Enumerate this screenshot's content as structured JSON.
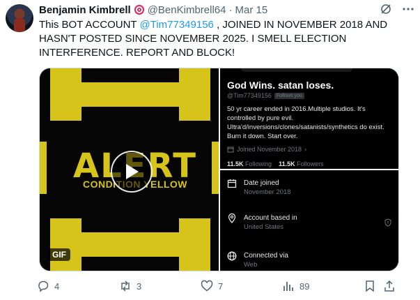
{
  "author": {
    "name": "Benjamin Kimbrell",
    "badge_icon": "target-icon",
    "handle": "@BenKimbrell64",
    "separator": "·",
    "date": "Mar 15"
  },
  "tweet": {
    "text_before": "This BOT ACCOUNT ",
    "mention": "@Tim77349156",
    "text_after": " , JOINED IN NOVEMBER 2018 AND HASN'T POSTED SINCE NOVEMBER 2025. I SMELL ELECTION INTERFERENCE. REPORT AND BLOCK!"
  },
  "media": {
    "gif": {
      "alert_text": "ALERT",
      "condition_text": "CONDITION YELLOW",
      "label": "GIF"
    },
    "profile": {
      "display_name": "God Wins. satan loses.",
      "handle": "@Tim77349156",
      "follows_tag": "Follows you",
      "bio": "50 yr career ended in 2016.Multiple studios. It's controlled by pure evil. Ultra'd/inversions/clones/satanists/synthetics do exist. Burn it down. Start over.",
      "joined": "Joined November 2018",
      "following_count": "11.5K",
      "following_label": "Following",
      "followers_count": "11.5K",
      "followers_label": "Followers"
    },
    "about": {
      "date_joined_label": "Date joined",
      "date_joined_value": "November 2018",
      "based_label": "Account based in",
      "based_value": "United States",
      "connected_label": "Connected via",
      "connected_value": "Web"
    }
  },
  "actions": {
    "replies": "4",
    "reposts": "3",
    "likes": "7",
    "views": "89"
  },
  "colors": {
    "accent": "#1d9bf0",
    "alert_yellow": "#d6c41a",
    "muted": "#536471"
  }
}
